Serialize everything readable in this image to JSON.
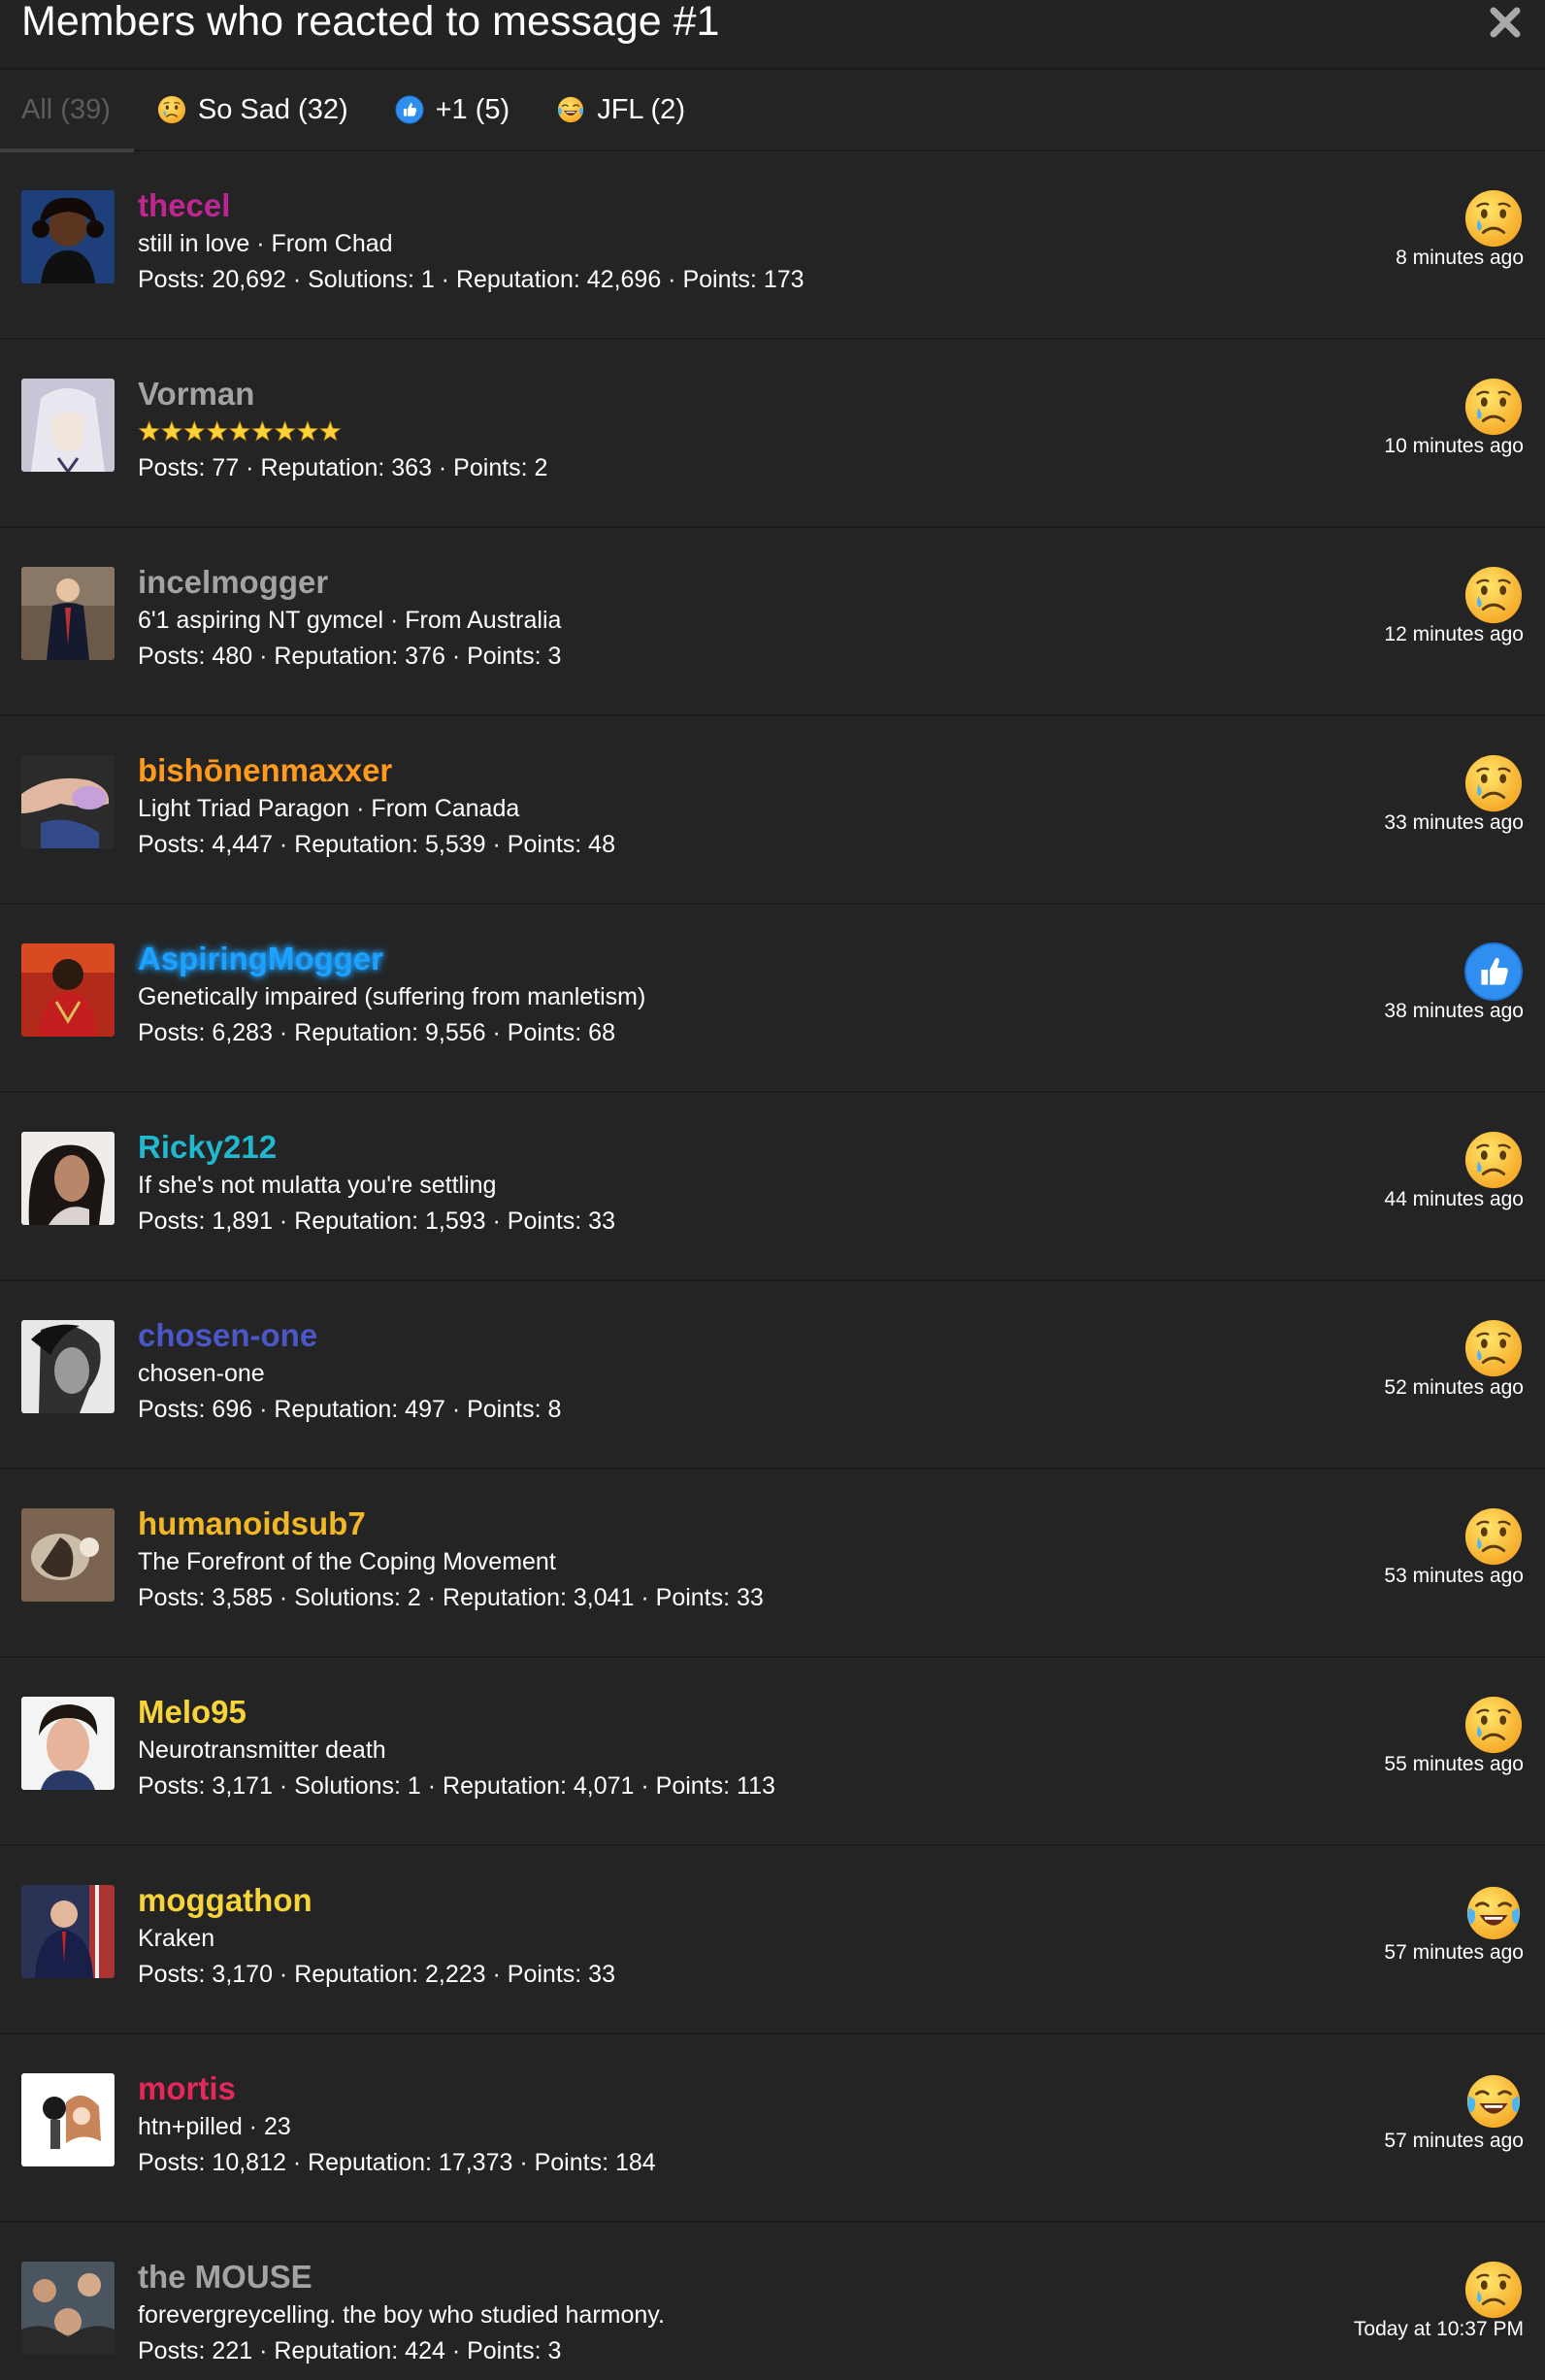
{
  "header": {
    "title": "Members who reacted to message #1"
  },
  "tabs": [
    {
      "label": "All (39)",
      "emoji": null
    },
    {
      "label": "So Sad (32)",
      "emoji": "sad"
    },
    {
      "label": "+1 (5)",
      "emoji": "thumbsup"
    },
    {
      "label": "JFL (2)",
      "emoji": "jfl"
    }
  ],
  "colors": {
    "background": "#242424",
    "divider": "#1b1b1b",
    "thecel": "#c0268f",
    "grey": "#a3a3a3",
    "orange": "#ff9a1f",
    "blue_glow": "#1ea0ff",
    "cyan": "#22b7cf",
    "indigo": "#4b57c9",
    "gold": "#f2b724",
    "yellow": "#f7d53a",
    "pink": "#e5285a"
  },
  "members": [
    {
      "username": "thecel",
      "subtitle": "still in love · From Chad",
      "stats": "Posts: 20,692 · Solutions: 1 · Reputation: 42,696 · Points: 173",
      "reaction": "sad",
      "time": "8 minutes ago",
      "avatar": "avatar-thecel"
    },
    {
      "username": "Vorman",
      "subtitle": "",
      "stars": 9,
      "stats": "Posts: 77 · Reputation: 363 · Points: 2",
      "reaction": "sad",
      "time": "10 minutes ago",
      "avatar": "avatar-vorman"
    },
    {
      "username": "incelmogger",
      "subtitle": "6'1 aspiring NT gymcel · From Australia",
      "stats": "Posts: 480 · Reputation: 376 · Points: 3",
      "reaction": "sad",
      "time": "12 minutes ago",
      "avatar": "avatar-incelmogger"
    },
    {
      "username": "bishōnenmaxxer",
      "subtitle": "Light Triad Paragon · From Canada",
      "stats": "Posts: 4,447 · Reputation: 5,539 · Points: 48",
      "reaction": "sad",
      "time": "33 minutes ago",
      "avatar": "avatar-bishonenmaxxer"
    },
    {
      "username": "AspiringMogger",
      "subtitle": "Genetically impaired (suffering from manletism)",
      "stats": "Posts: 6,283 · Reputation: 9,556 · Points: 68",
      "reaction": "thumbsup",
      "time": "38 minutes ago",
      "avatar": "avatar-aspiringmogger"
    },
    {
      "username": "Ricky212",
      "subtitle": "If she's not mulatta you're settling",
      "stats": "Posts: 1,891 · Reputation: 1,593 · Points: 33",
      "reaction": "sad",
      "time": "44 minutes ago",
      "avatar": "avatar-ricky212"
    },
    {
      "username": "chosen-one",
      "subtitle": "chosen-one",
      "stats": "Posts: 696 · Reputation: 497 · Points: 8",
      "reaction": "sad",
      "time": "52 minutes ago",
      "avatar": "avatar-chosen-one"
    },
    {
      "username": "humanoidsub7",
      "subtitle": "The Forefront of the Coping Movement",
      "stats": "Posts: 3,585 · Solutions: 2 · Reputation: 3,041 · Points: 33",
      "reaction": "sad",
      "time": "53 minutes ago",
      "avatar": "avatar-humanoidsub7"
    },
    {
      "username": "Melo95",
      "subtitle": "Neurotransmitter death",
      "stats": "Posts: 3,171 · Solutions: 1 · Reputation: 4,071 · Points: 113",
      "reaction": "sad",
      "time": "55 minutes ago",
      "avatar": "avatar-melo95"
    },
    {
      "username": "moggathon",
      "subtitle": "Kraken",
      "stats": "Posts: 3,170 · Reputation: 2,223 · Points: 33",
      "reaction": "jfl",
      "time": "57 minutes ago",
      "avatar": "avatar-moggathon"
    },
    {
      "username": "mortis",
      "subtitle": "htn+pilled · 23",
      "stats": "Posts: 10,812 · Reputation: 17,373 · Points: 184",
      "reaction": "jfl",
      "time": "57 minutes ago",
      "avatar": "avatar-mortis"
    },
    {
      "username": "the MOUSE",
      "subtitle": "forevergreycelling. the boy who studied harmony.",
      "stats": "Posts: 221 · Reputation: 424 · Points: 3",
      "reaction": "sad",
      "time": "Today at 10:37 PM",
      "avatar": "avatar-the-mouse"
    }
  ]
}
